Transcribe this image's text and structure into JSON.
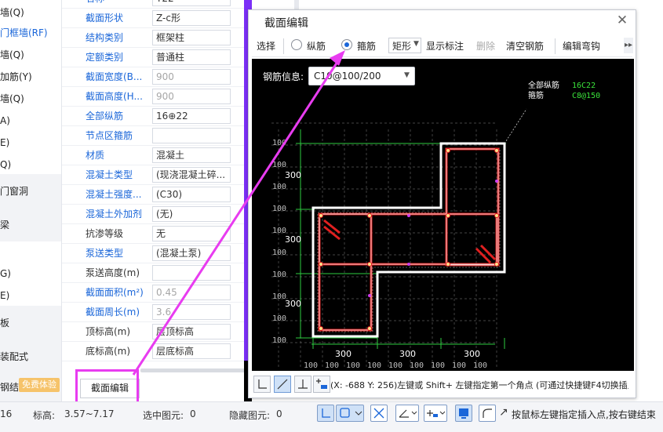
{
  "left_nav": {
    "items": [
      {
        "label": "墙(Q)"
      },
      {
        "label": "门框墙(RF)"
      },
      {
        "label": "墙(Q)"
      },
      {
        "label": "加筋(Y)"
      },
      {
        "label": "墙(Q)"
      },
      {
        "label": "A)"
      },
      {
        "label": "E)"
      },
      {
        "label": "Q)"
      },
      {
        "label": "门窗洞"
      },
      {
        "label": "梁"
      },
      {
        "label": "G)"
      },
      {
        "label": "E)"
      },
      {
        "label": "板"
      },
      {
        "label": "装配式"
      },
      {
        "label": "钢结"
      }
    ],
    "trial_badge": "免费体验"
  },
  "properties": {
    "top_cut_value": "T22",
    "top_cut_name": "名称",
    "rows": [
      {
        "name": "截面形状",
        "value": "Z-c形"
      },
      {
        "name": "结构类别",
        "value": "框架柱"
      },
      {
        "name": "定额类别",
        "value": "普通柱"
      },
      {
        "name": "截面宽度(B...",
        "value": "900"
      },
      {
        "name": "截面高度(H...",
        "value": "900"
      },
      {
        "name": "全部纵筋",
        "value": "16⊕22"
      },
      {
        "name": "节点区箍筋",
        "value": ""
      },
      {
        "name": "材质",
        "value": "混凝土"
      },
      {
        "name": "混凝土类型",
        "value": "(现浇混凝土碎..."
      },
      {
        "name": "混凝土强度...",
        "value": "(C30)"
      },
      {
        "name": "混凝土外加剂",
        "value": "(无)"
      },
      {
        "name": "抗渗等级",
        "value": "无"
      },
      {
        "name": "泵送类型",
        "value": "(混凝土泵)"
      },
      {
        "name": "泵送高度(m)",
        "value": ""
      },
      {
        "name": "截面面积(m²)",
        "value": "0.45"
      },
      {
        "name": "截面周长(m)",
        "value": "3.6"
      },
      {
        "name": "顶标高(m)",
        "value": "层顶标高"
      },
      {
        "name": "底标高(m)",
        "value": "层底标高"
      }
    ],
    "edit_button": "截面编辑"
  },
  "dialog": {
    "title": "截面编辑",
    "toolbar": {
      "select": "选择",
      "longitudinal": "纵筋",
      "stirrup": "箍筋",
      "shape": "矩形",
      "show_labels": "显示标注",
      "delete": "删除",
      "clear_rebar": "清空钢筋",
      "edit_hook": "编辑弯钩"
    },
    "rebar_info_label": "钢筋信息:",
    "rebar_info_value": "C10@100/200",
    "legend": {
      "all_long_key": "全部纵筋",
      "all_long_val": "16C22",
      "stirrup_key": "箍筋",
      "stirrup_val": "C8@150"
    },
    "dims": {
      "left": [
        "300",
        "300",
        "300"
      ],
      "bottom": [
        "300",
        "300",
        "300"
      ],
      "tick_left": "100",
      "tick_bottom": "100"
    },
    "coord_text": "(X: -688 Y: 256)左键或 Shift+ 左键指定第一个角点 (可通过快捷键F4切换插入点)"
  },
  "bottom_bar": {
    "left_value": "16",
    "elevation_label": "标高:",
    "elevation_value": "3.57~7.17",
    "selected_label": "选中图元:",
    "selected_value": "0",
    "hidden_label": "隐藏图元:",
    "hidden_value": "0",
    "hint": "按鼠标左键指定插入点,按右键结束"
  },
  "colors": {
    "accent_blue": "#1a66d9",
    "highlight_magenta": "#e83cf0",
    "rebar_red": "#e02020",
    "dim_green": "#2ecc40",
    "canvas_black": "#000000"
  }
}
